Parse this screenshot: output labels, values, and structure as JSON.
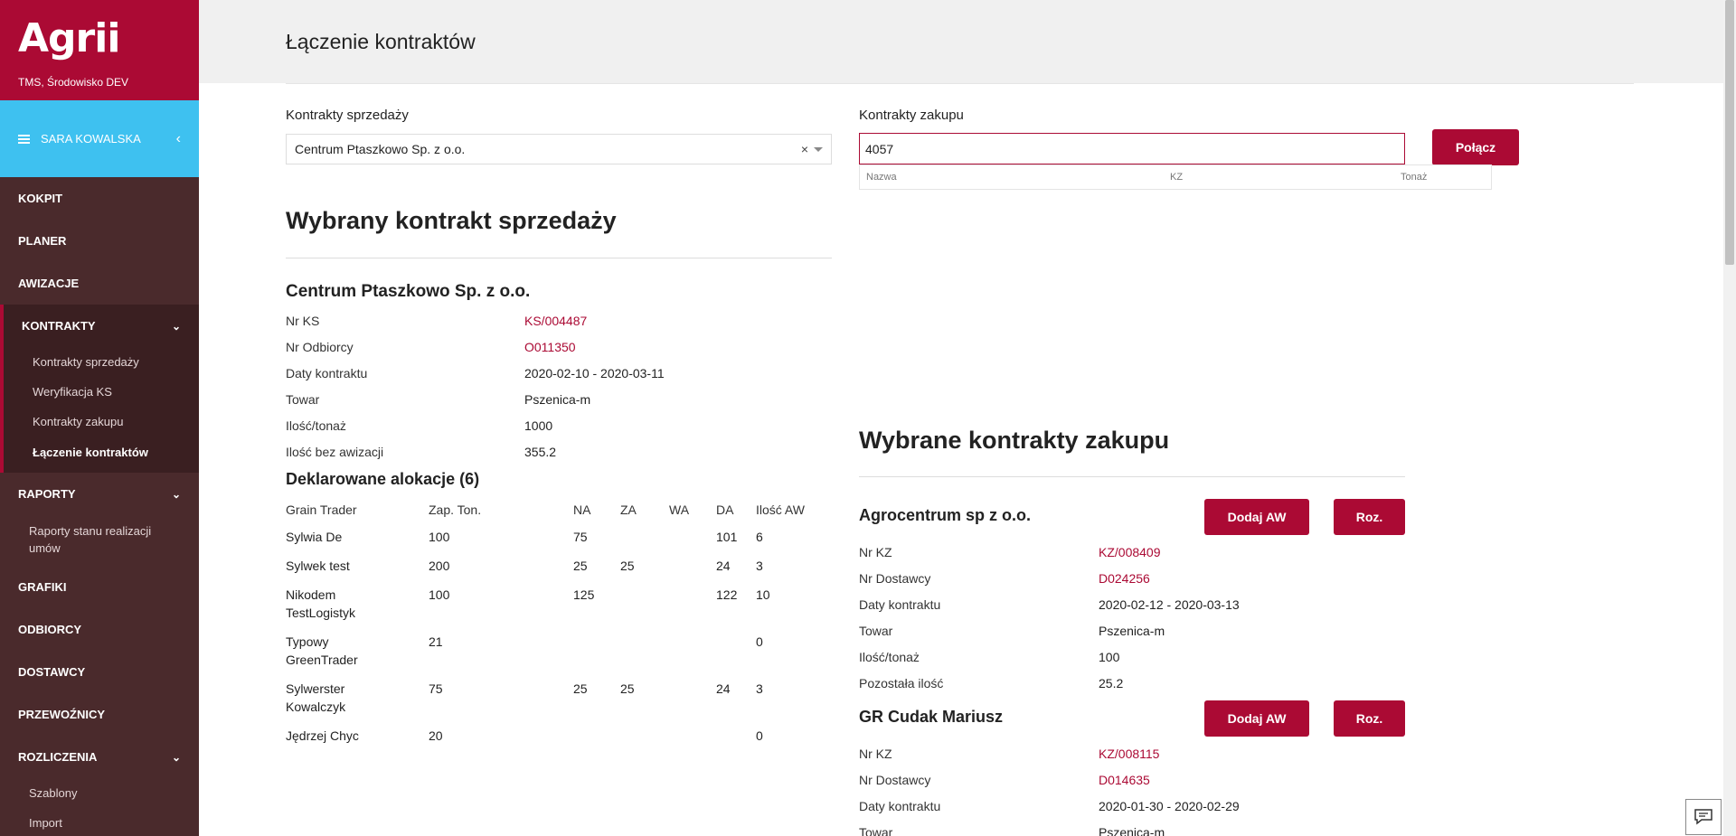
{
  "brand": {
    "logo": "Agrii",
    "env": "TMS, Środowisko DEV"
  },
  "user": {
    "name": "SARA KOWALSKA"
  },
  "nav": {
    "kokpit": "KOKPIT",
    "planer": "PLANER",
    "awizacje": "AWIZACJE",
    "kontrakty": "KONTRAKTY",
    "kontrakty_sub": [
      "Kontrakty sprzedaży",
      "Weryfikacja KS",
      "Kontrakty zakupu",
      "Łączenie kontraktów"
    ],
    "raporty": "RAPORTY",
    "raporty_sub": "Raporty stanu realizacji umów",
    "grafiki": "GRAFIKI",
    "odbiorcy": "ODBIORCY",
    "dostawcy": "DOSTAWCY",
    "przewoznicy": "PRZEWOŹNICY",
    "rozliczenia": "ROZLICZENIA",
    "rozliczenia_sub": [
      "Szablony",
      "Import"
    ]
  },
  "page": {
    "title": "Łączenie kontraktów"
  },
  "sales": {
    "label": "Kontrakty sprzedaży",
    "selected": "Centrum Ptaszkowo Sp. z o.o.",
    "clear": "×",
    "heading": "Wybrany kontrakt sprzedaży",
    "company": "Centrum Ptaszkowo Sp. z o.o.",
    "fields": [
      {
        "k": "Nr KS",
        "v": "KS/004487",
        "link": true
      },
      {
        "k": "Nr Odbiorcy",
        "v": "O011350",
        "link": true
      },
      {
        "k": "Daty kontraktu",
        "v": "2020-02-10 - 2020-03-11",
        "link": false
      },
      {
        "k": "Towar",
        "v": "Pszenica-m",
        "link": false
      },
      {
        "k": "Ilość/tonaż",
        "v": "1000",
        "link": false
      },
      {
        "k": "Ilość bez awizacji",
        "v": "355.2",
        "link": false
      }
    ],
    "alloc_title": "Deklarowane alokacje (6)",
    "alloc_headers": [
      "Grain Trader",
      "Zap. Ton.",
      "NA",
      "ZA",
      "WA",
      "DA",
      "Ilość AW"
    ],
    "alloc_rows": [
      [
        "Sylwia De",
        "100",
        "75",
        "",
        "",
        "101",
        "6"
      ],
      [
        "Sylwek test",
        "200",
        "25",
        "25",
        "",
        "24",
        "3"
      ],
      [
        "Nikodem TestLogistyk",
        "100",
        "125",
        "",
        "",
        "122",
        "10"
      ],
      [
        "Typowy GreenTrader",
        "21",
        "",
        "",
        "",
        "",
        "0"
      ],
      [
        "Sylwerster Kowalczyk",
        "75",
        "25",
        "25",
        "",
        "24",
        "3"
      ],
      [
        "Jędrzej Chyc",
        "20",
        "",
        "",
        "",
        "",
        "0"
      ]
    ]
  },
  "purchase": {
    "label": "Kontrakty zakupu",
    "input_value": "4057",
    "connect_button": "Połącz",
    "dropdown_cols": [
      "Nazwa",
      "KZ",
      "Tonaż"
    ],
    "heading": "Wybrane kontrakty zakupu",
    "add_button": "Dodaj AW",
    "roz_button": "Roz.",
    "suppliers": [
      {
        "name": "Agrocentrum sp z o.o.",
        "fields": [
          {
            "k": "Nr KZ",
            "v": "KZ/008409",
            "link": true
          },
          {
            "k": "Nr Dostawcy",
            "v": "D024256",
            "link": true
          },
          {
            "k": "Daty kontraktu",
            "v": "2020-02-12 - 2020-03-13",
            "link": false
          },
          {
            "k": "Towar",
            "v": "Pszenica-m",
            "link": false
          },
          {
            "k": "Ilość/tonaż",
            "v": "100",
            "link": false
          },
          {
            "k": "Pozostała ilość",
            "v": "25.2",
            "link": false
          }
        ]
      },
      {
        "name": "GR Cudak Mariusz",
        "fields": [
          {
            "k": "Nr KZ",
            "v": "KZ/008115",
            "link": true
          },
          {
            "k": "Nr Dostawcy",
            "v": "D014635",
            "link": true
          },
          {
            "k": "Daty kontraktu",
            "v": "2020-01-30 - 2020-02-29",
            "link": false
          },
          {
            "k": "Towar",
            "v": "Pszenica-m",
            "link": false
          }
        ]
      }
    ]
  },
  "colors": {
    "brand": "#ab0a34",
    "sidebar": "#4a2a2c",
    "user_bar": "#3ec1f0"
  },
  "icons": {
    "menu": "hamburger-icon",
    "collapse": "chevron-left-icon",
    "expand": "chevron-down-icon",
    "clear": "close-icon",
    "caret": "caret-down-icon",
    "chat": "feedback-icon"
  }
}
